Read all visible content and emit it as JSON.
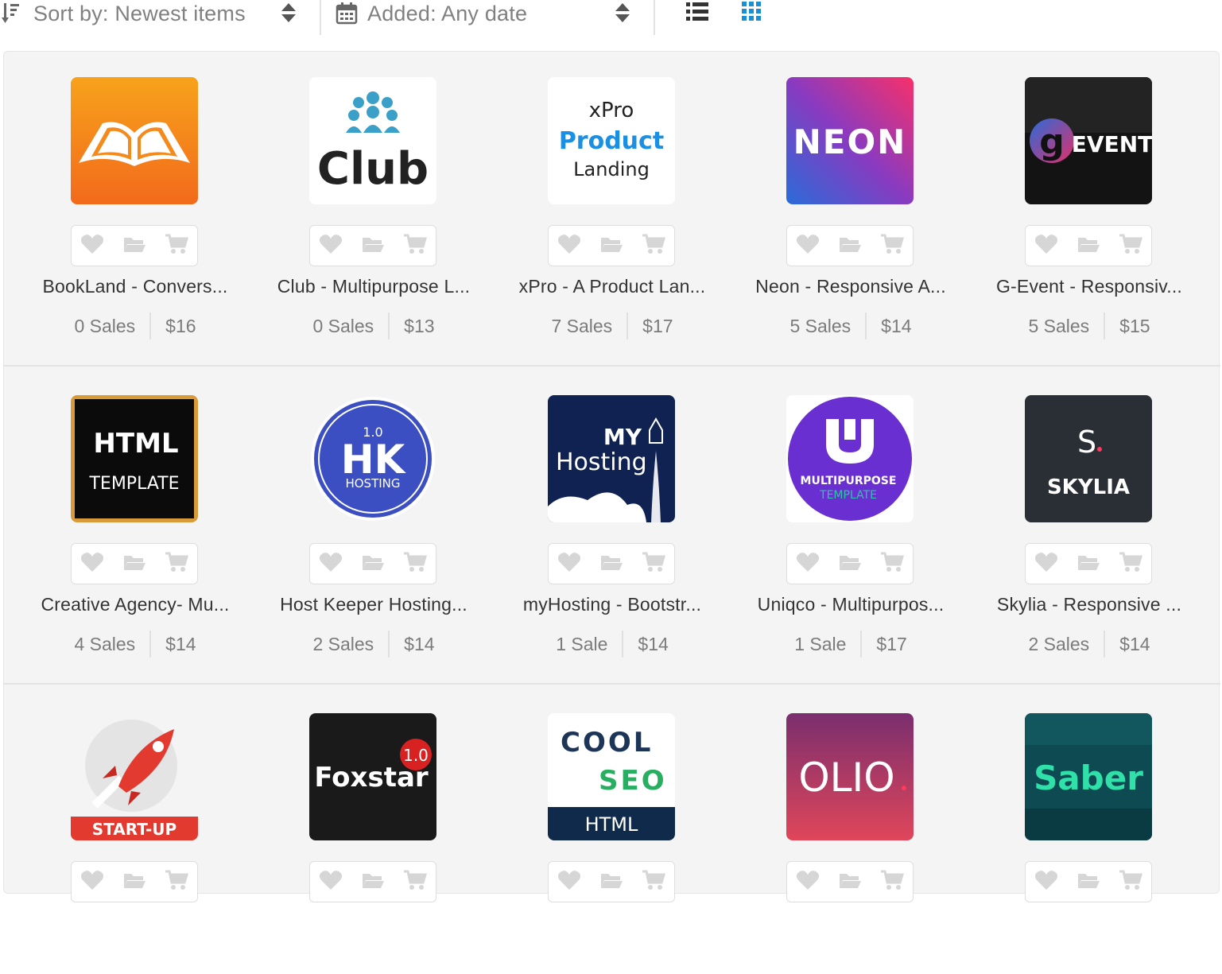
{
  "toolbar": {
    "sort_label": "Sort by: Newest items",
    "date_label": "Added: Any date",
    "sort_icon": "sort-amount-icon",
    "date_icon": "calendar-icon",
    "list_view_icon": "list-view-icon",
    "grid_view_icon": "grid-view-icon",
    "active_view": "grid",
    "accent_color": "#1a8fd1"
  },
  "items": [
    {
      "title": "BookLand - Convers...",
      "sales": "0 Sales",
      "price": "$16",
      "thumb": "bookland"
    },
    {
      "title": "Club - Multipurpose L...",
      "sales": "0 Sales",
      "price": "$13",
      "thumb": "club",
      "thumb_text": "Club"
    },
    {
      "title": "xPro - A Product Lan...",
      "sales": "7 Sales",
      "price": "$17",
      "thumb": "xpro",
      "thumb_lines": [
        "xPro",
        "Product",
        "Landing"
      ]
    },
    {
      "title": "Neon - Responsive A...",
      "sales": "5 Sales",
      "price": "$14",
      "thumb": "neon",
      "thumb_text": "NEON"
    },
    {
      "title": "G-Event - Responsiv...",
      "sales": "5 Sales",
      "price": "$15",
      "thumb": "gevent",
      "thumb_lines": [
        "g",
        "EVENT"
      ]
    },
    {
      "title": "Creative Agency- Mu...",
      "sales": "4 Sales",
      "price": "$14",
      "thumb": "htmltemplate",
      "thumb_lines": [
        "HTML",
        "TEMPLATE"
      ]
    },
    {
      "title": "Host Keeper Hosting...",
      "sales": "2 Sales",
      "price": "$14",
      "thumb": "hk",
      "thumb_lines": [
        "1.0",
        "HK",
        "HOSTING"
      ]
    },
    {
      "title": "myHosting - Bootstr...",
      "sales": "1 Sale",
      "price": "$14",
      "thumb": "myhosting",
      "thumb_lines": [
        "MY",
        "Hosting"
      ]
    },
    {
      "title": "Uniqco - Multipurpos...",
      "sales": "1 Sale",
      "price": "$17",
      "thumb": "uniqco",
      "thumb_lines": [
        "MULTIPURPOSE",
        "TEMPLATE"
      ]
    },
    {
      "title": "Skylia - Responsive ...",
      "sales": "2 Sales",
      "price": "$14",
      "thumb": "skylia",
      "thumb_lines": [
        "S.",
        "SKYLIA"
      ]
    },
    {
      "title": "",
      "sales": "",
      "price": "",
      "thumb": "startup",
      "thumb_text": "START-UP"
    },
    {
      "title": "",
      "sales": "",
      "price": "",
      "thumb": "foxstar",
      "thumb_lines": [
        "Foxstar",
        "1.0"
      ]
    },
    {
      "title": "",
      "sales": "",
      "price": "",
      "thumb": "coolseo",
      "thumb_lines": [
        "COOL",
        "SEO",
        "HTML"
      ]
    },
    {
      "title": "",
      "sales": "",
      "price": "",
      "thumb": "olio",
      "thumb_text": "OLIO"
    },
    {
      "title": "",
      "sales": "",
      "price": "",
      "thumb": "saber",
      "thumb_text": "Saber"
    }
  ],
  "action_icons": [
    "heart-icon",
    "folder-icon",
    "cart-icon"
  ]
}
